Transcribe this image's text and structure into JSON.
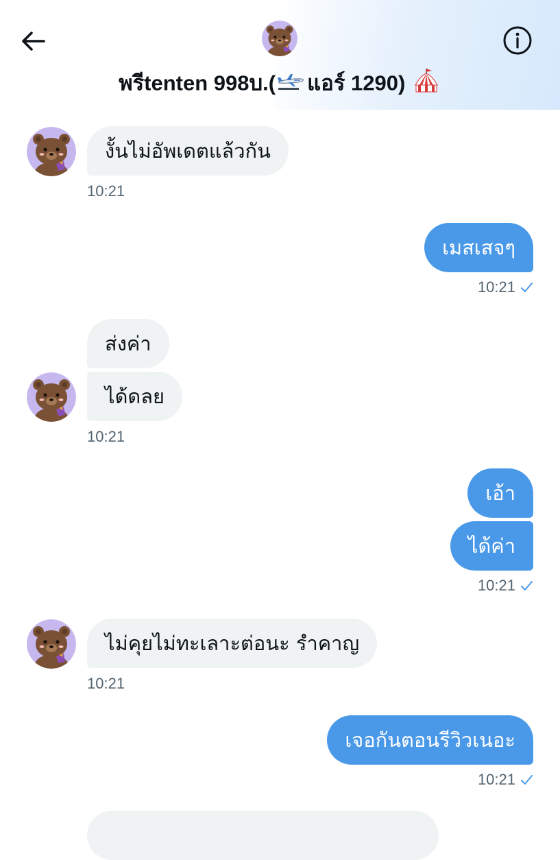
{
  "header": {
    "title_prefix": "พรีtenten 998บ.(",
    "title_middle": "แอร์ 1290)",
    "title_emoji_1": "airplane-icon",
    "title_emoji_2": "circus-tent-icon",
    "back_icon": "back-arrow-icon",
    "info_icon": "info-icon",
    "avatar": "bear-avatar"
  },
  "messages": [
    {
      "side": "in",
      "text": "งั้นไม่อัพเดตแล้วกัน"
    },
    {
      "side": "in",
      "time": "10:21"
    },
    {
      "side": "out",
      "text": "เมสเสจๆ"
    },
    {
      "side": "out",
      "time": "10:21"
    },
    {
      "side": "in",
      "text": "ส่งค่า"
    },
    {
      "side": "in",
      "text": "ได้ดลย"
    },
    {
      "side": "in",
      "time": "10:21"
    },
    {
      "side": "out",
      "text": "เอ้า"
    },
    {
      "side": "out",
      "text": "ได้ค่า"
    },
    {
      "side": "out",
      "time": "10:21"
    },
    {
      "side": "in",
      "text": "ไม่คุยไม่ทะเลาะต่อนะ รำคาญ"
    },
    {
      "side": "in",
      "time": "10:21"
    },
    {
      "side": "out",
      "text": "เจอกันตอนรีวิวเนอะ"
    },
    {
      "side": "out",
      "time": "10:21"
    }
  ],
  "colors": {
    "outgoing_bubble": "#4a99e9",
    "incoming_bubble": "#eff3f4",
    "timestamp": "#536471",
    "check": "#4a99e9",
    "avatar_bg": "#c6b8ef"
  },
  "status_icon": "read-check-icon"
}
